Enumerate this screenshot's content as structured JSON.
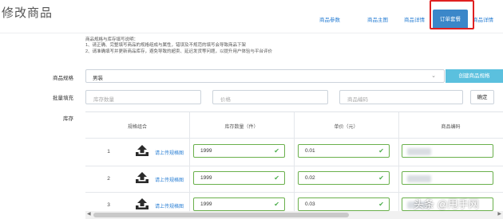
{
  "page_title": "修改商品",
  "tabs": [
    {
      "label": "商品参数"
    },
    {
      "label": "商品主图"
    },
    {
      "label": "商品详情"
    },
    {
      "label": "订单套餐"
    },
    {
      "label": "商品详情"
    }
  ],
  "notes": [
    "商品规格与库存填写说明：",
    "1、请正确、完整填写商品的规格组成与属性，错误及不规范的填写会导致商品下架",
    "2、请准确填写并更新商品库存，避免导致的超卖、延迟发货等问题，以提升用户体验与平台评价"
  ],
  "spec": {
    "label": "商品规格",
    "selected": "男装",
    "create_button": "创建商品规格"
  },
  "batch": {
    "label": "批量填充",
    "stock_placeholder": "库存数量",
    "price_placeholder": "价格",
    "code_placeholder": "商品编码",
    "confirm_button": "确定"
  },
  "stock": {
    "label": "库存",
    "headers": [
      "规格组合",
      "库存数量（件）",
      "单价（元）",
      "商品编码"
    ],
    "rows": [
      {
        "index": "1",
        "upload_link": "请上传规格图",
        "quantity": "1999",
        "price": "0.01"
      },
      {
        "index": "2",
        "upload_link": "请上传规格图",
        "quantity": "1999",
        "price": "0.02"
      },
      {
        "index": "3",
        "upload_link": "请上传规格图",
        "quantity": "1999",
        "price": "0.03"
      }
    ]
  },
  "watermark": "头条 @甩手网",
  "colors": {
    "accent": "#3b87c9",
    "link": "#2a7fd4",
    "create_button": "#5bc0de",
    "valid_border": "#6ab04c",
    "highlight_box": "#e02020"
  },
  "icons": [
    "upload-icon",
    "check-icon",
    "chevron-down-icon"
  ]
}
